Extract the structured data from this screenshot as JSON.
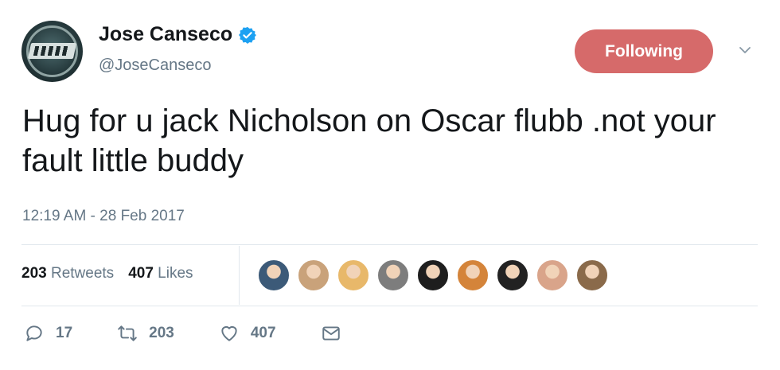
{
  "author": {
    "display_name": "Jose Canseco",
    "handle": "@JoseCanseco",
    "verified": true
  },
  "follow_button": {
    "label": "Following",
    "color": "#d66a6a"
  },
  "tweet": {
    "text": "Hug for u jack Nicholson on Oscar flubb .not your fault little buddy",
    "timestamp": "12:19 AM - 28 Feb 2017"
  },
  "stats": {
    "retweets_count": "203",
    "retweets_label": "Retweets",
    "likes_count": "407",
    "likes_label": "Likes"
  },
  "actions": {
    "reply_count": "17",
    "retweet_count": "203",
    "like_count": "407"
  },
  "likers": [
    {
      "color": "#3c5a78"
    },
    {
      "color": "#c9a27a"
    },
    {
      "color": "#e8b86a"
    },
    {
      "color": "#7d7d7d"
    },
    {
      "color": "#1e1e1e"
    },
    {
      "color": "#d4843a"
    },
    {
      "color": "#222222"
    },
    {
      "color": "#d9a48a"
    },
    {
      "color": "#8a6a4a"
    }
  ],
  "colors": {
    "accent_blue": "#1da1f2",
    "muted": "#657786",
    "text": "#14171a"
  }
}
